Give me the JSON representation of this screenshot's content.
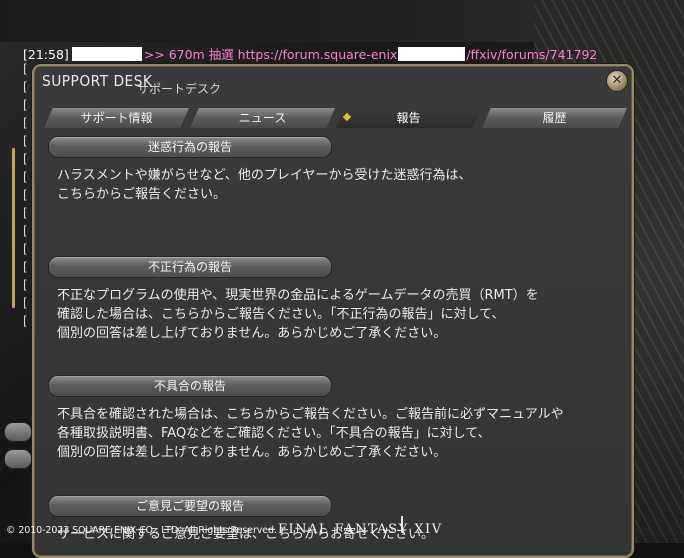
{
  "chat": {
    "time": "[21:58]",
    "line_mid": ">> 670m 抽選 https://forum.square-enix",
    "line_end": "/ffxiv/forums/741792",
    "bracket_rows": [
      "[",
      "[",
      "[",
      "[",
      "[",
      "[",
      "[",
      "[",
      "[",
      "[",
      "[",
      "[",
      "[",
      "[",
      "["
    ]
  },
  "window": {
    "title": "SUPPORT DESK",
    "subtitle": "サポートデスク",
    "close_label": "✕"
  },
  "tabs": [
    {
      "label": "サポート情報",
      "active": false
    },
    {
      "label": "ニュース",
      "active": false
    },
    {
      "label": "報告",
      "active": true
    },
    {
      "label": "履歴",
      "active": false
    }
  ],
  "sections": [
    {
      "header": "迷惑行為の報告",
      "body": "ハラスメントや嫌がらせなど、他のプレイヤーから受けた迷惑行為は、\nこちらからご報告ください。"
    },
    {
      "header": "不正行為の報告",
      "body": "不正なプログラムの使用や、現実世界の金品によるゲームデータの売買（RMT）を\n確認した場合は、こちらからご報告ください。「不正行為の報告」に対して、\n個別の回答は差し上げておりません。あらかじめご了承ください。"
    },
    {
      "header": "不具合の報告",
      "body": "不具合を確認された場合は、こちらからご報告ください。ご報告前に必ずマニュアルや\n各種取扱説明書、FAQなどをご確認ください。「不具合の報告」に対して、\n個別の回答は差し上げておりません。あらかじめご了承ください。"
    },
    {
      "header": "ご意見ご要望の報告",
      "body": "サービスに関するご意見ご要望は、こちらからお寄せください。"
    }
  ],
  "footer": {
    "copyright": "© 2010-2023 SQUARE ENIX CO., LTD. All Rights Reserved.",
    "logo": "FINAL FANTASY XIV"
  },
  "colors": {
    "accent_gold": "#c9a246",
    "chat_pink": "#ff7fcf",
    "window_bg": "#3a3a3a"
  }
}
